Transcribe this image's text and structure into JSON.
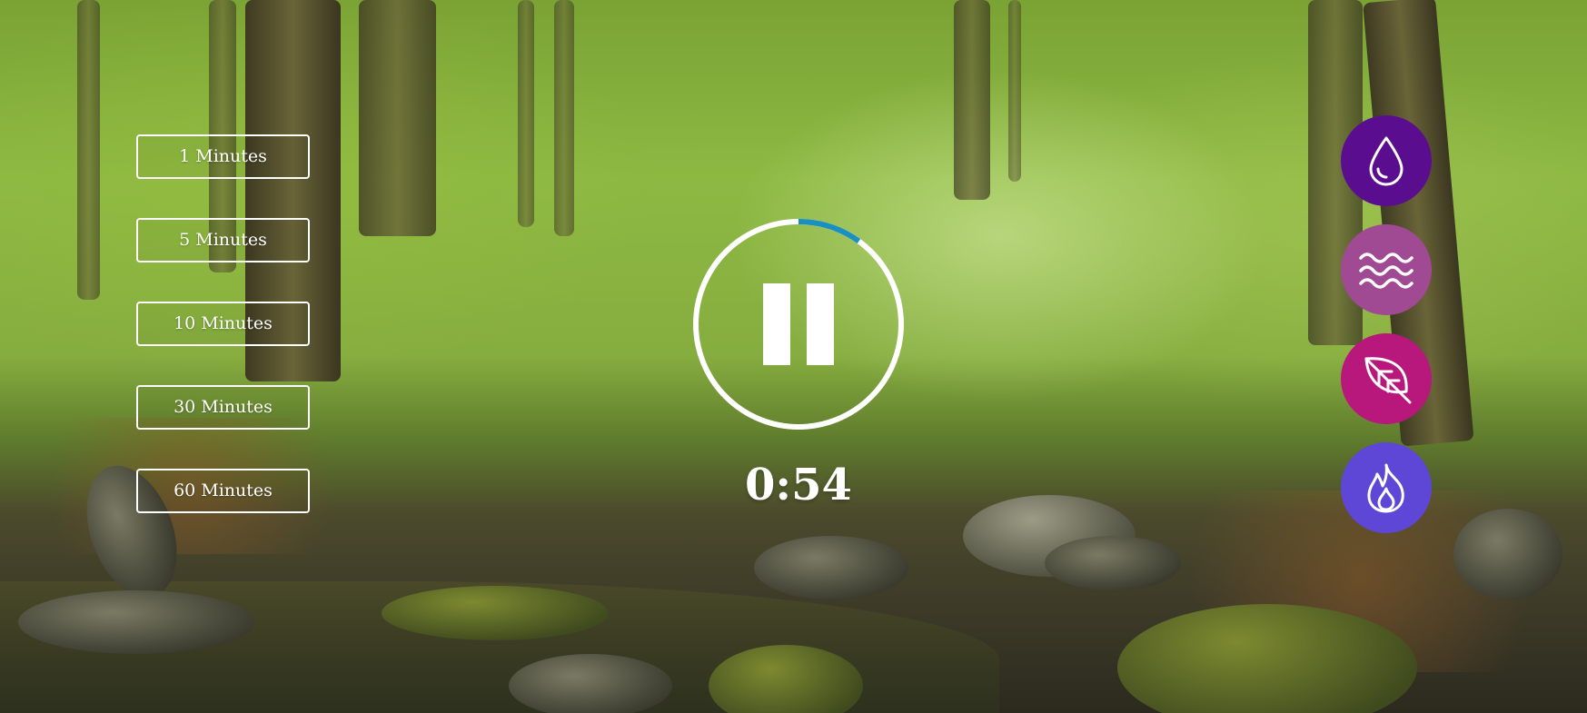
{
  "durations": [
    {
      "label": "1 Minutes"
    },
    {
      "label": "5 Minutes"
    },
    {
      "label": "10 Minutes"
    },
    {
      "label": "30 Minutes"
    },
    {
      "label": "60 Minutes"
    }
  ],
  "player": {
    "state": "playing",
    "timer_text": "0:54",
    "progress_fraction": 0.1,
    "ring_color": "#ffffff",
    "progress_color": "#1a8fc2"
  },
  "sounds": [
    {
      "name": "rain",
      "icon": "water-drop-icon",
      "color": "#5b0d8f"
    },
    {
      "name": "waves",
      "icon": "waves-icon",
      "color": "#a04a94"
    },
    {
      "name": "forest",
      "icon": "leaf-icon",
      "color": "#b8177c"
    },
    {
      "name": "fire",
      "icon": "flame-icon",
      "color": "#5e47d6"
    }
  ]
}
